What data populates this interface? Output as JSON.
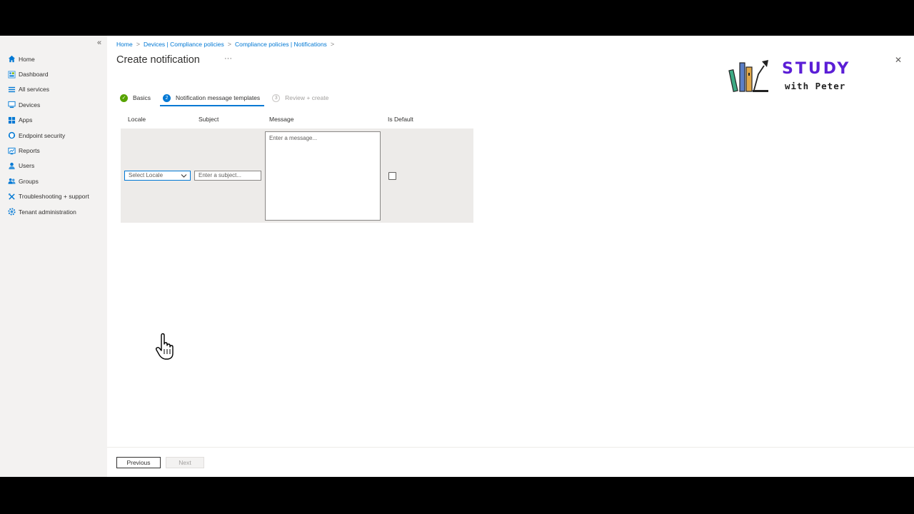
{
  "sidebar": {
    "collapse_label": "«",
    "items": [
      {
        "label": "Home",
        "icon": "home-icon",
        "color": "#0078d4"
      },
      {
        "label": "Dashboard",
        "icon": "dashboard-icon",
        "color": "#3a96dd"
      },
      {
        "label": "All services",
        "icon": "all-services-icon",
        "color": "#0078d4"
      },
      {
        "label": "Devices",
        "icon": "devices-icon",
        "color": "#0078d4"
      },
      {
        "label": "Apps",
        "icon": "apps-icon",
        "color": "#0078d4"
      },
      {
        "label": "Endpoint security",
        "icon": "endpoint-security-icon",
        "color": "#0078d4"
      },
      {
        "label": "Reports",
        "icon": "reports-icon",
        "color": "#0078d4"
      },
      {
        "label": "Users",
        "icon": "users-icon",
        "color": "#0078d4"
      },
      {
        "label": "Groups",
        "icon": "groups-icon",
        "color": "#0078d4"
      },
      {
        "label": "Troubleshooting + support",
        "icon": "troubleshooting-icon",
        "color": "#0078d4"
      },
      {
        "label": "Tenant administration",
        "icon": "tenant-admin-icon",
        "color": "#0078d4"
      }
    ]
  },
  "breadcrumb": {
    "items": [
      "Home",
      "Devices | Compliance policies",
      "Compliance policies | Notifications"
    ],
    "separator": ">"
  },
  "page": {
    "title": "Create notification",
    "more_label": "···",
    "close_label": "✕"
  },
  "logo": {
    "line1": "STUDY",
    "line2": "with Peter"
  },
  "steps": [
    {
      "label": "Basics",
      "state": "done",
      "marker": "✓"
    },
    {
      "label": "Notification message templates",
      "state": "active",
      "marker": "2"
    },
    {
      "label": "Review + create",
      "state": "pending",
      "marker": "3"
    }
  ],
  "grid": {
    "columns": [
      "Locale",
      "Subject",
      "Message",
      "Is Default"
    ],
    "locale_placeholder": "Select Locale",
    "subject_placeholder": "Enter a subject...",
    "message_placeholder": "Enter a message...",
    "is_default_checked": false
  },
  "footer": {
    "previous_label": "Previous",
    "next_label": "Next",
    "next_enabled": false
  },
  "colors": {
    "accent": "#0078d4",
    "success": "#57a300",
    "brand_purple": "#5b1ed6"
  }
}
